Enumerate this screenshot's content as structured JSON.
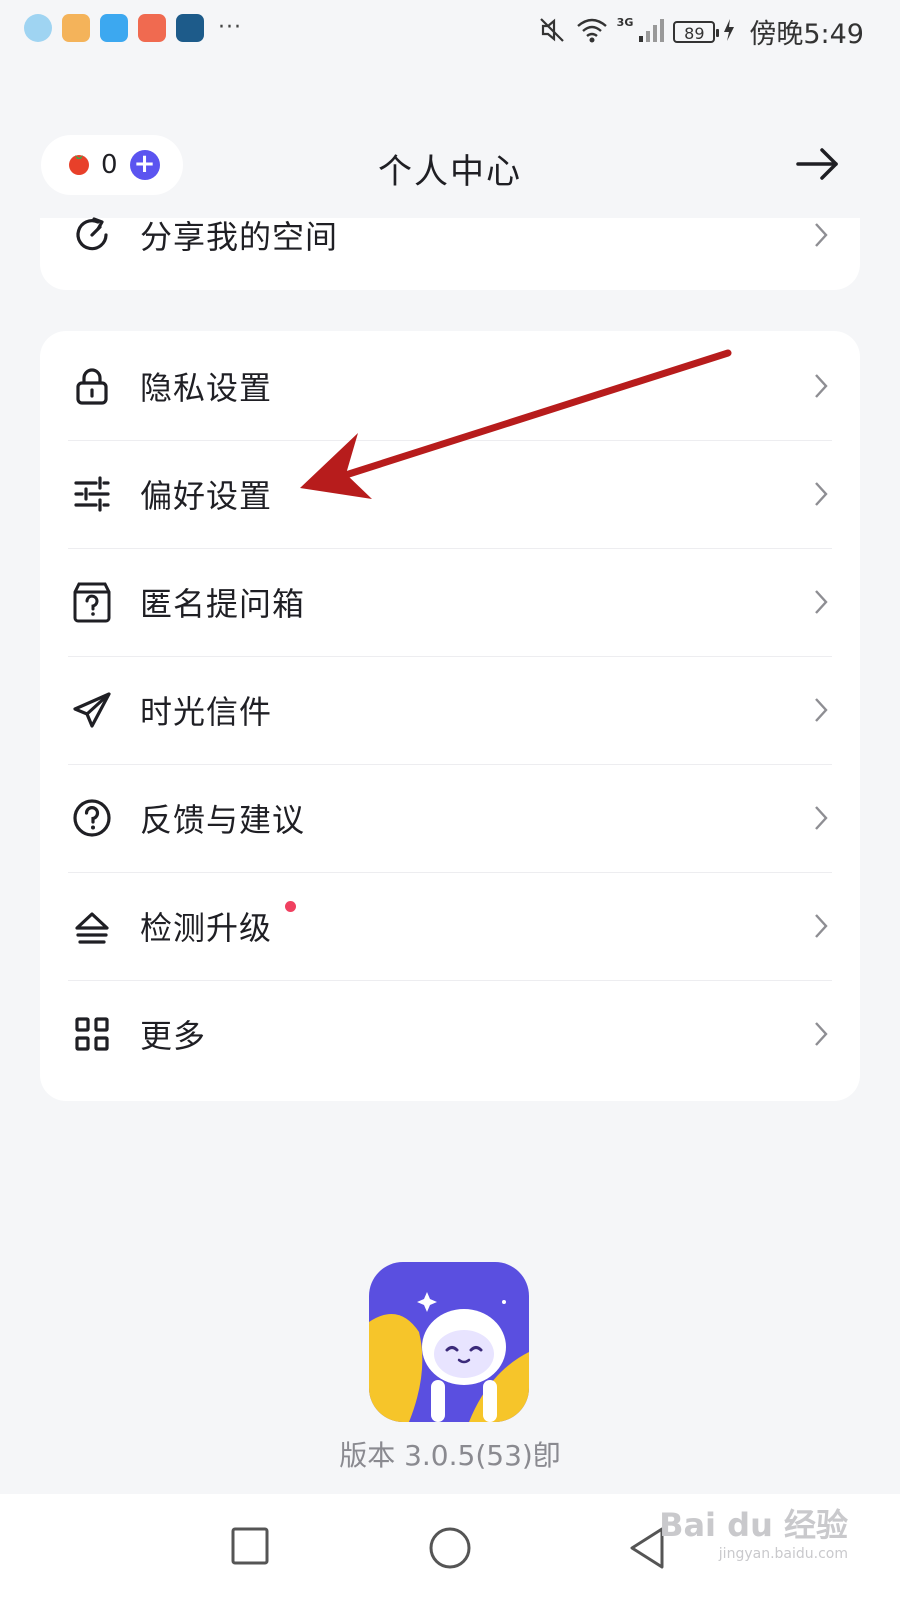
{
  "status_bar": {
    "signal_label": "3G",
    "battery": "89",
    "time": "傍晚5:49",
    "more_indicator": "···",
    "app_icons": [
      "maps-app-icon",
      "package-app-icon",
      "shield-app-icon",
      "wallet-app-icon",
      "lucky-app-icon"
    ]
  },
  "header": {
    "coin_count": "0",
    "title": "个人中心"
  },
  "menu_top": {
    "label": "分享我的空间",
    "icon": "share-refresh-icon"
  },
  "menu": [
    {
      "label": "隐私设置",
      "icon": "lock-icon"
    },
    {
      "label": "偏好设置",
      "icon": "sliders-icon"
    },
    {
      "label": "匿名提问箱",
      "icon": "question-box-icon"
    },
    {
      "label": "时光信件",
      "icon": "paper-plane-icon"
    },
    {
      "label": "反馈与建议",
      "icon": "help-circle-icon"
    },
    {
      "label": "检测升级",
      "icon": "upgrade-icon",
      "badge": "red-dot"
    },
    {
      "label": "更多",
      "icon": "grid-icon"
    }
  ],
  "footer": {
    "version": "版本 3.0.5(53)卽"
  },
  "colors": {
    "accent": "#5b54f0",
    "background": "#f5f6f8",
    "card": "#ffffff",
    "annotation_arrow": "#b71c1c",
    "badge": "#f04060"
  },
  "watermark": {
    "text": "Bai du 经验",
    "sub": "jingyan.baidu.com"
  }
}
